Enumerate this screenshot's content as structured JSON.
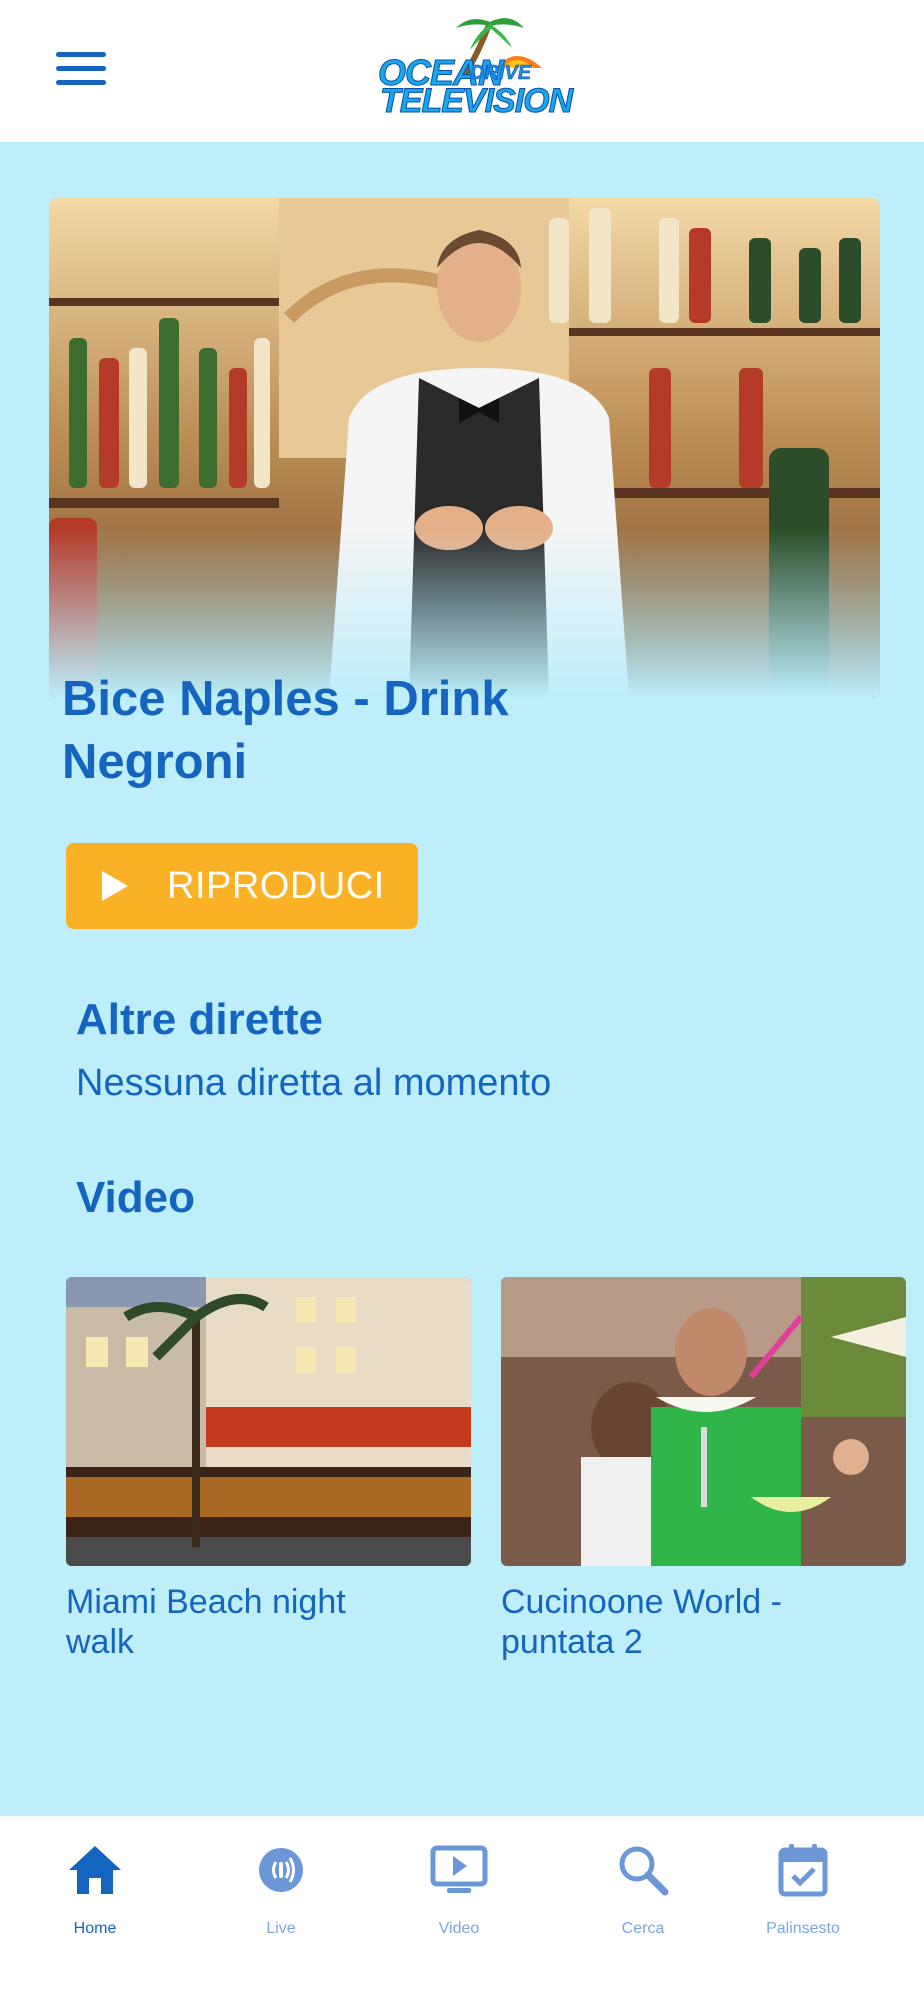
{
  "app": {
    "logo_name": "Ocean Drive Television"
  },
  "header": {
    "logo": {
      "word1": "OCEAN",
      "word2": "DRIVE",
      "word3": "TELEVISION"
    }
  },
  "hero": {
    "title": "Bice Naples - Drink Negroni",
    "play_label": "RIPRODUCI"
  },
  "live_section": {
    "title": "Altre dirette",
    "empty_text": "Nessuna diretta al momento"
  },
  "video_section": {
    "title": "Video",
    "items": [
      {
        "title": "Miami Beach night walk"
      },
      {
        "title": "Cucinoone World - puntata 2"
      }
    ]
  },
  "bottom_nav": {
    "items": [
      {
        "label": "Home",
        "icon": "home-icon",
        "active": true
      },
      {
        "label": "Live",
        "icon": "live-icon",
        "active": false
      },
      {
        "label": "Video",
        "icon": "video-icon",
        "active": false
      },
      {
        "label": "Cerca",
        "icon": "search-icon",
        "active": false
      },
      {
        "label": "Palinsesto",
        "icon": "calendar-icon",
        "active": false
      }
    ]
  },
  "colors": {
    "accent": "#1565c0",
    "background": "#bdeefa",
    "play_button": "#fbb126",
    "nav_inactive": "#7aa7e0"
  }
}
